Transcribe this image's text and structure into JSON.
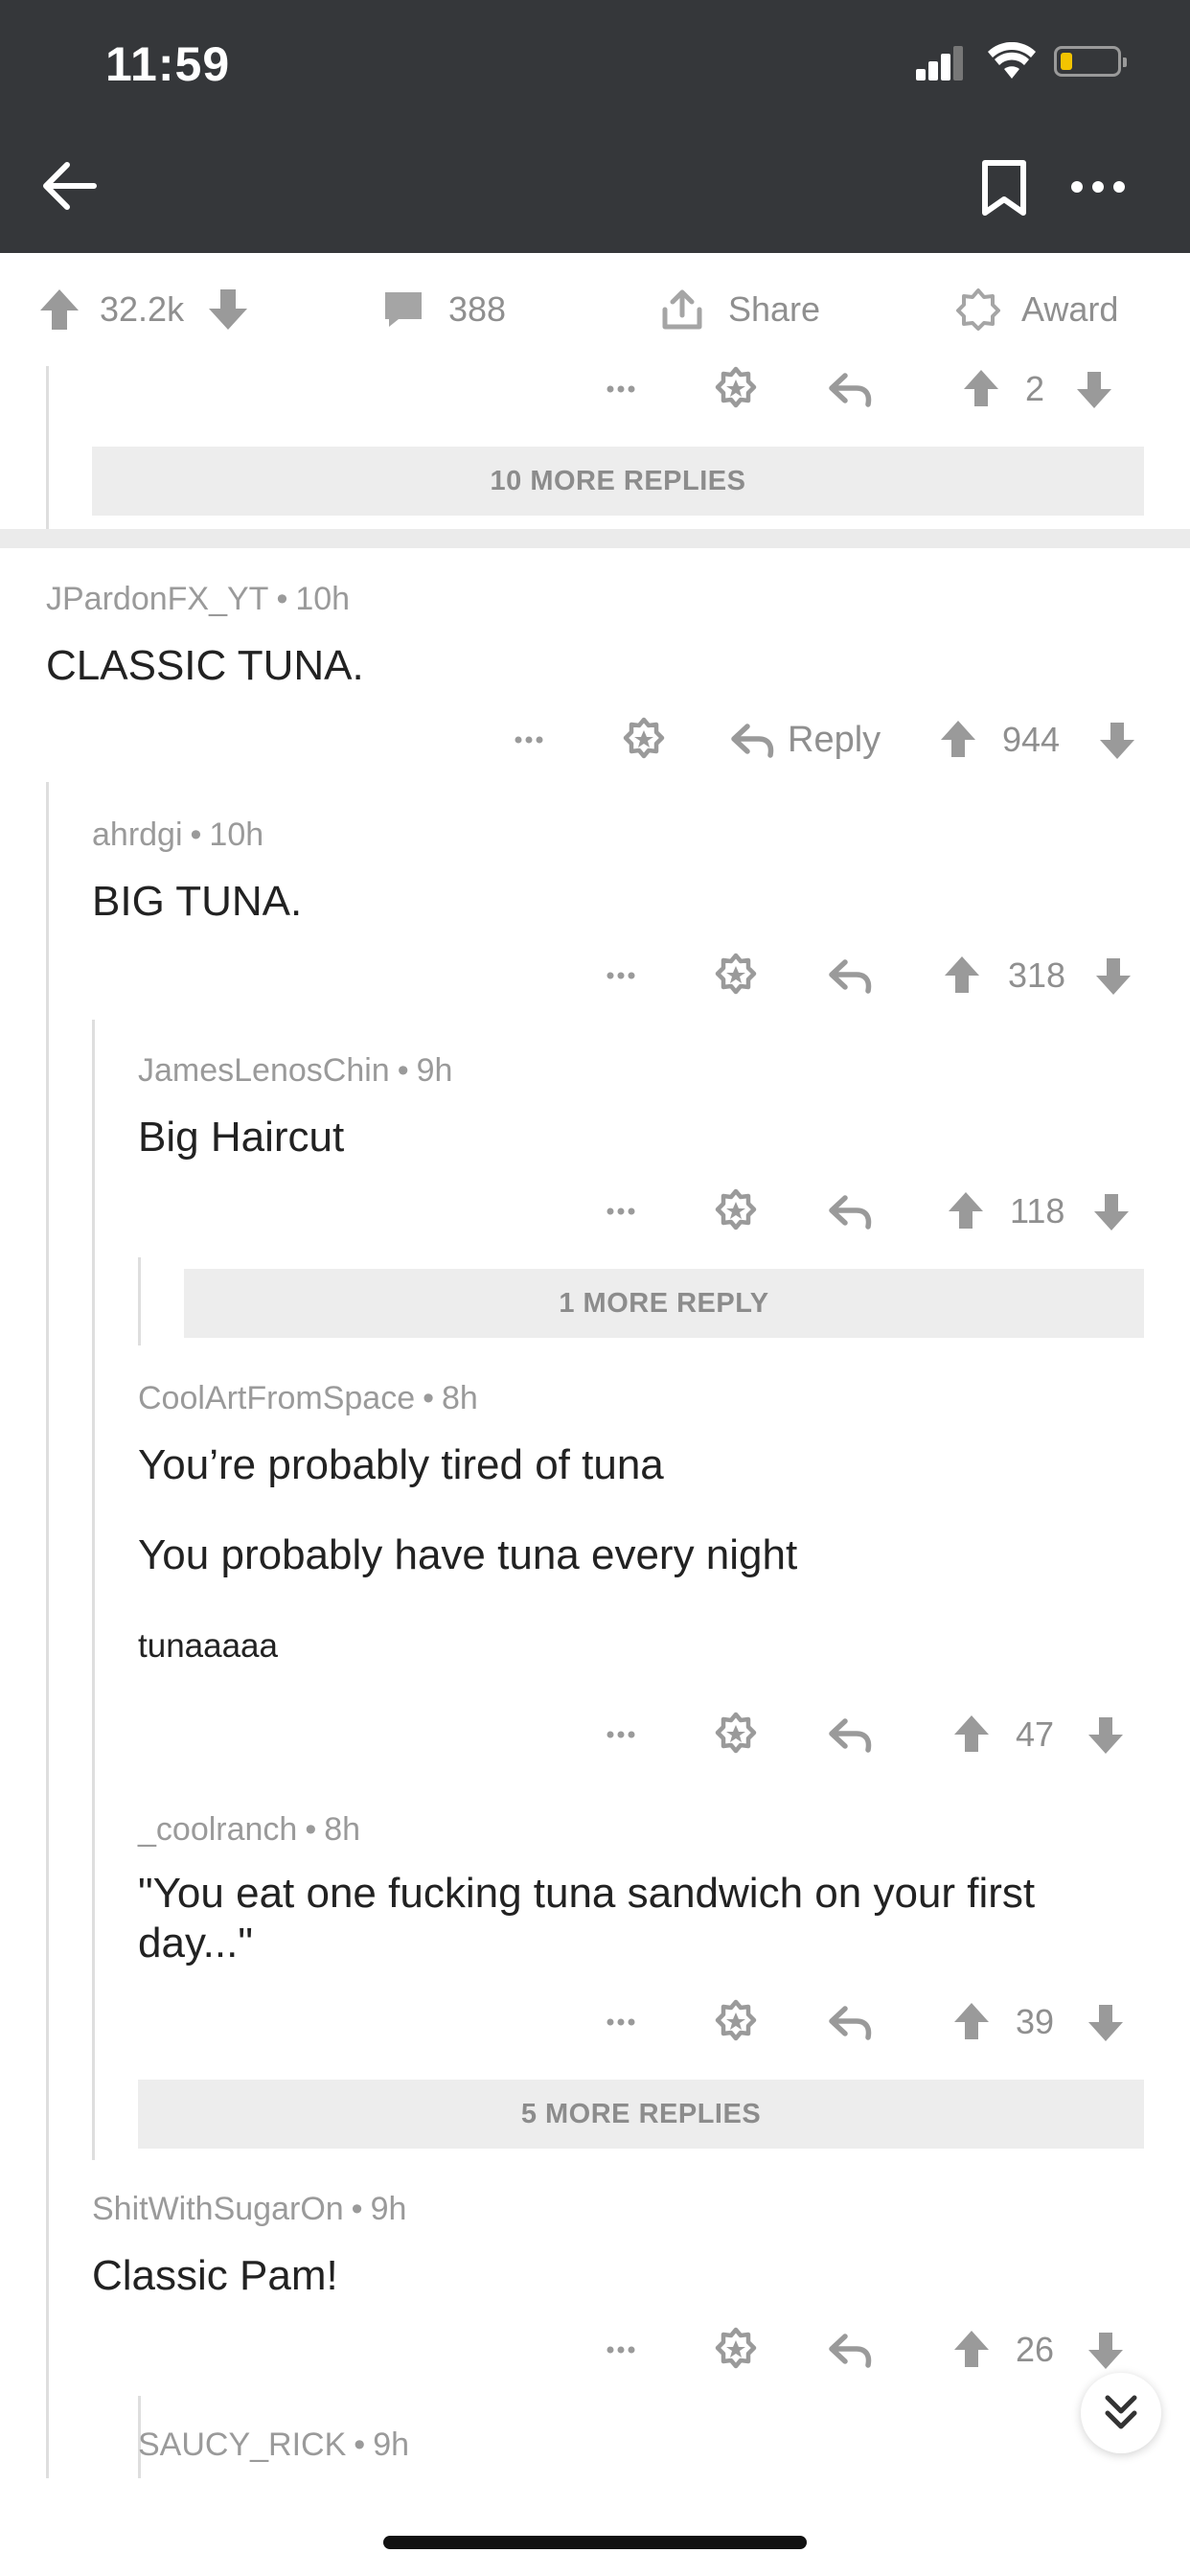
{
  "status_bar": {
    "time": "11:59"
  },
  "post_actions": {
    "upvotes": "32.2k",
    "comments": "388",
    "share": "Share",
    "award": "Award"
  },
  "first_row": {
    "score": "2"
  },
  "more_replies": {
    "first": "10 MORE REPLIES",
    "haircut": "1 MORE REPLY",
    "coolranch": "5 MORE REPLIES"
  },
  "comments": [
    {
      "user": "JPardonFX_YT",
      "time": "10h",
      "body": "CLASSIC TUNA.",
      "score": "944",
      "reply_label": "Reply"
    },
    {
      "user": "ahrdgi",
      "time": "10h",
      "body": "BIG TUNA.",
      "score": "318"
    },
    {
      "user": "JamesLenosChin",
      "time": "9h",
      "body": "Big Haircut",
      "score": "118"
    },
    {
      "user": "CoolArtFromSpace",
      "time": "8h",
      "lines": [
        "You’re probably tired of tuna",
        "You probably have tuna every night",
        "tunaaaaa"
      ],
      "score": "47"
    },
    {
      "user": "_coolranch",
      "time": "8h",
      "body": "\"You eat one fucking tuna sandwich on your first day...\"",
      "score": "39"
    },
    {
      "user": "ShitWithSugarOn",
      "time": "9h",
      "body": "Classic Pam!",
      "score": "26"
    },
    {
      "user": "SAUCY_RICK",
      "time": "9h"
    }
  ],
  "icons": {
    "back": "arrow-left-icon",
    "bookmark": "bookmark-icon",
    "more": "more-horizontal-icon",
    "upvote": "upvote-arrow-icon",
    "downvote": "downvote-arrow-icon",
    "comment": "comment-bubble-icon",
    "share": "share-icon",
    "award": "award-icon",
    "reply": "reply-arrow-icon",
    "scroll_down": "double-chevron-down-icon"
  },
  "colors": {
    "header_bg": "#35373a",
    "icon_gray": "#8f8f8f",
    "more_bar_bg": "#ededed"
  }
}
